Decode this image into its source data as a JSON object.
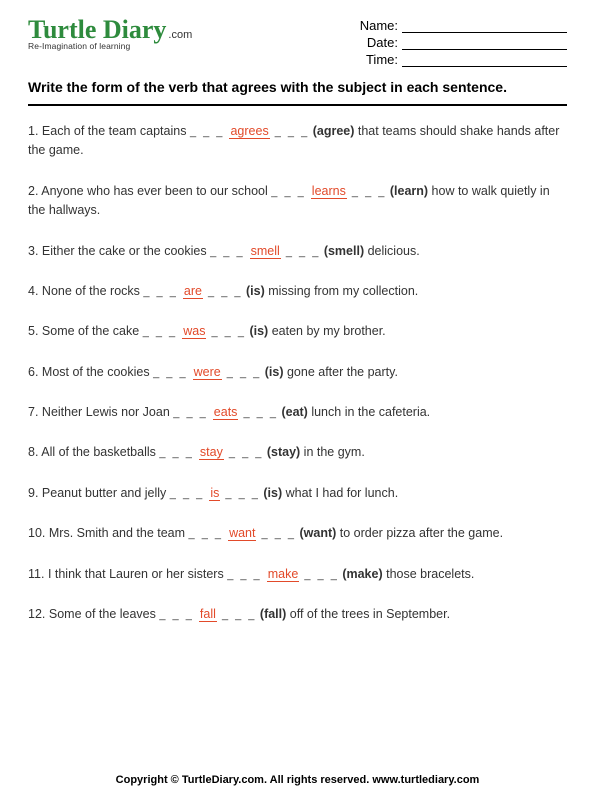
{
  "logo": {
    "brand": "Turtle Diary",
    "dotcom": ".com",
    "tagline": "Re-Imagination of learning"
  },
  "info": {
    "name_label": "Name:",
    "date_label": "Date:",
    "time_label": "Time:"
  },
  "instructions": "Write the form of the verb that agrees with the subject in each sentence.",
  "questions": [
    {
      "n": "1.",
      "pre": "Each of the team captains",
      "ans": "agrees",
      "hint": "(agree)",
      "post": " that teams should shake hands after the game."
    },
    {
      "n": "2.",
      "pre": "Anyone who has ever been to our school",
      "ans": "learns",
      "hint": "(learn)",
      "post": " how to walk quietly in the hallways."
    },
    {
      "n": "3.",
      "pre": "Either the cake or the cookies",
      "ans": "smell",
      "hint": "(smell)",
      "post": " delicious."
    },
    {
      "n": "4.",
      "pre": "None of the rocks",
      "ans": "are",
      "hint": "(is)",
      "post": " missing from my collection."
    },
    {
      "n": "5.",
      "pre": "Some of the cake",
      "ans": "was",
      "hint": "(is)",
      "post": " eaten by my brother."
    },
    {
      "n": "6.",
      "pre": "Most of the cookies",
      "ans": "were",
      "hint": "(is)",
      "post": " gone after the party."
    },
    {
      "n": "7.",
      "pre": "Neither Lewis nor Joan",
      "ans": "eats",
      "hint": "(eat)",
      "post": " lunch in the cafeteria."
    },
    {
      "n": "8.",
      "pre": "All of the basketballs",
      "ans": "stay",
      "hint": "(stay)",
      "post": " in the gym."
    },
    {
      "n": "9.",
      "pre": "Peanut butter and jelly",
      "ans": "is",
      "hint": "(is)",
      "post": " what I had for lunch."
    },
    {
      "n": "10.",
      "pre": "Mrs. Smith and the team",
      "ans": "want",
      "hint": "(want)",
      "post": " to order pizza after the game."
    },
    {
      "n": "11.",
      "pre": "I think that Lauren or her sisters",
      "ans": "make",
      "hint": "(make)",
      "post": " those bracelets."
    },
    {
      "n": "12.",
      "pre": "Some of the leaves",
      "ans": "fall",
      "hint": "(fall)",
      "post": " off of the trees in September."
    }
  ],
  "footer": "Copyright © TurtleDiary.com. All rights reserved. www.turtlediary.com"
}
